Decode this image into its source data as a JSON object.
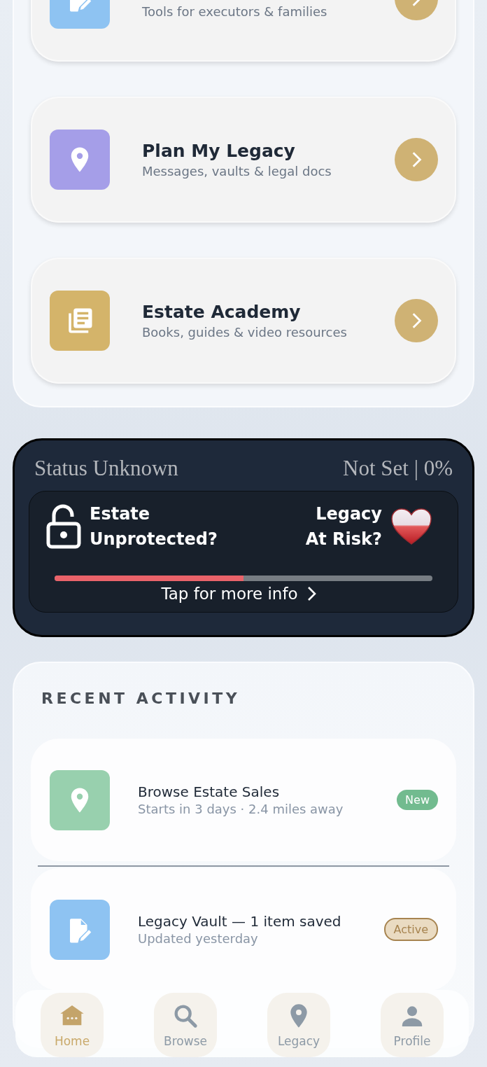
{
  "feature_cards": [
    {
      "kind": "edit",
      "color": "#8ec3f2",
      "subtitle": "Tools for executors & families"
    },
    {
      "kind": "pin",
      "color": "#a59ee8",
      "title": "Plan My Legacy",
      "subtitle": "Messages, vaults & legal docs"
    },
    {
      "kind": "book",
      "color": "#d4b46a",
      "title": "Estate Academy",
      "subtitle": "Books, guides & video resources"
    }
  ],
  "status_card": {
    "title": "Status Unknown",
    "summary": "Not Set | 0%",
    "estate_label": "Estate Unprotected?",
    "legacy_label": "Legacy At Risk?",
    "level": 0.5,
    "link": "Tap for more info"
  },
  "recent_activity": {
    "heading": "RECENT ACTIVITY",
    "items": [
      {
        "kind": "pin",
        "color": "#98d0ae",
        "title": "Browse Estate Sales",
        "subtitle": "Starts in 3 days · 2.4 miles away",
        "badge": {
          "text": "New",
          "kind": "filled"
        }
      },
      {
        "kind": "edit",
        "color": "#8ec3f2",
        "title": "Legacy Vault — 1 item saved",
        "subtitle": "Updated yesterday",
        "badge": {
          "text": "Active",
          "kind": "outlined"
        }
      }
    ]
  },
  "bottom_nav": [
    {
      "kind": "home",
      "label": "Home",
      "selected": true
    },
    {
      "kind": "search",
      "label": "Browse",
      "selected": false
    },
    {
      "kind": "pin",
      "label": "Legacy",
      "selected": false
    },
    {
      "kind": "profile",
      "label": "Profile",
      "selected": false
    }
  ]
}
